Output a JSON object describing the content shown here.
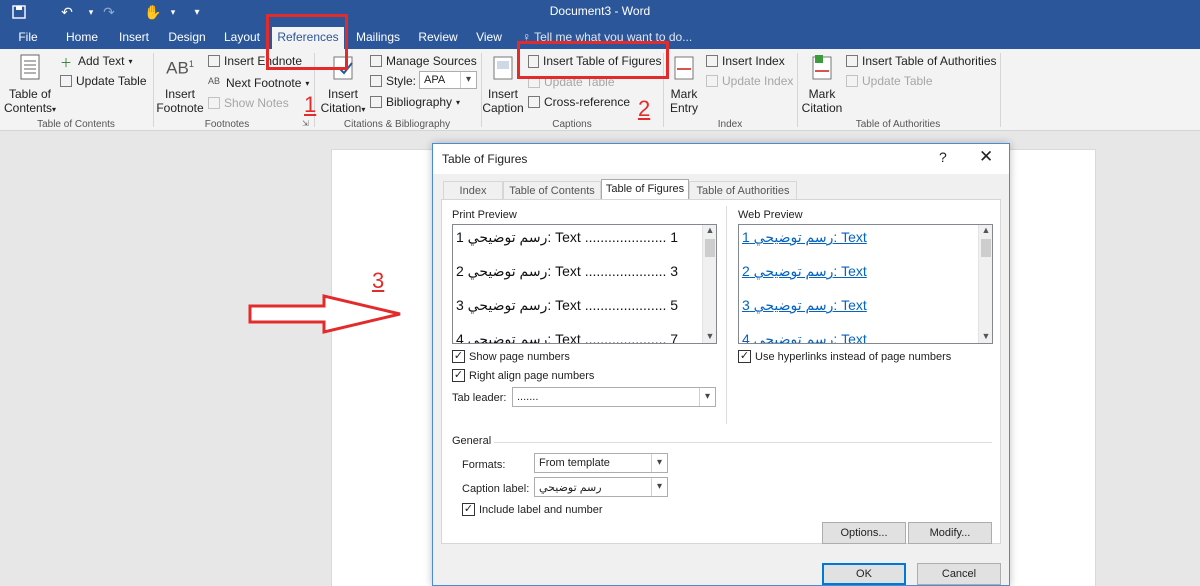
{
  "window": {
    "title": "Document3 - Word",
    "quick_access": [
      "save-icon",
      "undo-icon",
      "redo-icon",
      "touch-mode-icon",
      "customize-icon"
    ]
  },
  "ribbon_tabs": [
    "File",
    "Home",
    "Insert",
    "Design",
    "Layout",
    "References",
    "Mailings",
    "Review",
    "View"
  ],
  "tell_me": "Tell me what you want to do...",
  "ribbon": {
    "toc": {
      "big": "Table of\nContents",
      "add_text": "Add Text",
      "update_table": "Update Table",
      "label": "Table of Contents"
    },
    "footnotes": {
      "big": "Insert\nFootnote",
      "insert_endnote": "Insert Endnote",
      "next_footnote": "Next Footnote",
      "show_notes": "Show Notes",
      "label": "Footnotes"
    },
    "citations": {
      "big": "Insert\nCitation",
      "manage_sources": "Manage Sources",
      "style_label": "Style:",
      "style_value": "APA",
      "bibliography": "Bibliography",
      "label": "Citations & Bibliography"
    },
    "captions": {
      "big": "Insert\nCaption",
      "insert_tof": "Insert Table of Figures",
      "update_table": "Update Table",
      "cross_ref": "Cross-reference",
      "label": "Captions"
    },
    "index": {
      "big": "Mark\nEntry",
      "insert_index": "Insert Index",
      "update_index": "Update Index",
      "label": "Index"
    },
    "authorities": {
      "big": "Mark\nCitation",
      "insert_toa": "Insert Table of Authorities",
      "update_table": "Update Table",
      "label": "Table of Authorities"
    }
  },
  "annotations": {
    "n1": "1",
    "n2": "2",
    "n3": "3"
  },
  "dialog": {
    "title": "Table of Figures",
    "help": "?",
    "close": "✕",
    "tabs": [
      "Index",
      "Table of Contents",
      "Table of Figures",
      "Table of Authorities"
    ],
    "active_tab": "Table of Figures",
    "print_preview_label": "Print Preview",
    "print_rows": [
      "رسم توضيحي 1: Text ..................... 1",
      "رسم توضيحي 2: Text ..................... 3",
      "رسم توضيحي 3: Text ..................... 5",
      "رسم توضيحي 4: Text ..................... 7"
    ],
    "web_preview_label": "Web Preview",
    "web_rows": [
      "رسم توضيحي 1: Text",
      "رسم توضيحي 2: Text",
      "رسم توضيحي 3: Text",
      "رسم توضيحي 4: Text"
    ],
    "show_page_numbers": "Show page numbers",
    "right_align": "Right align page numbers",
    "tab_leader_label": "Tab leader:",
    "tab_leader_value": ".......",
    "use_hyperlinks": "Use hyperlinks instead of page numbers",
    "general_label": "General",
    "formats_label": "Formats:",
    "formats_value": "From template",
    "caption_label_label": "Caption label:",
    "caption_label_value": "رسم توضيحي",
    "include_label": "Include label and number",
    "options_btn": "Options...",
    "modify_btn": "Modify...",
    "ok_btn": "OK",
    "cancel_btn": "Cancel"
  },
  "colors": {
    "accent": "#2b579a",
    "annotation": "#e32b2b",
    "link": "#0563c1"
  }
}
